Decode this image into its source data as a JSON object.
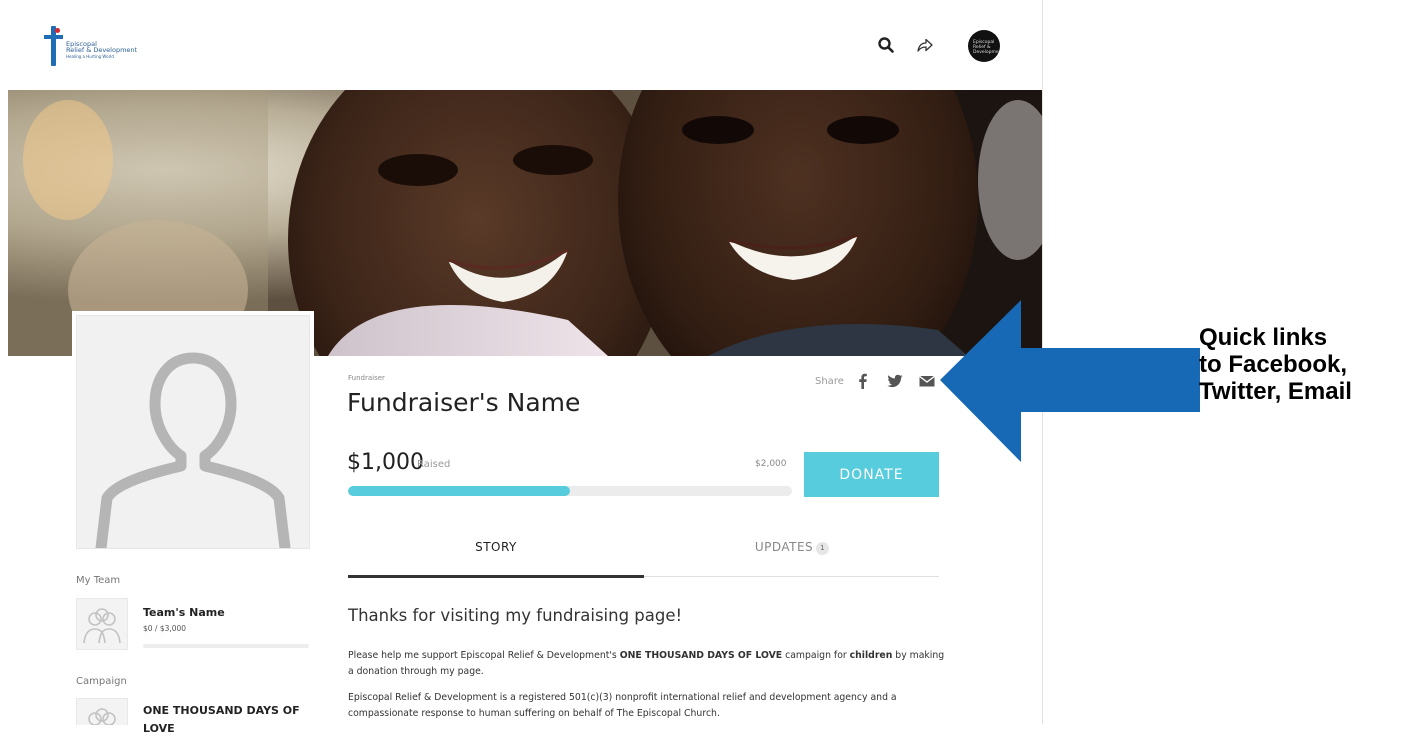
{
  "header": {
    "logo": {
      "line1": "Episcopal",
      "line2": "Relief & Development",
      "tagline": "Healing a Hurting World"
    },
    "icons": {
      "search": "search-icon",
      "share": "share-arrow-icon"
    },
    "avatar_text": "Episcopal Relief & Development"
  },
  "fundraiser": {
    "label": "Fundraiser",
    "name": "Fundraiser's Name",
    "share_label": "Share",
    "share_icons": [
      "facebook-icon",
      "twitter-icon",
      "email-icon"
    ],
    "raised": "$1,000",
    "raised_label": "Raised",
    "goal": "$2,000",
    "progress_fraction": 0.5,
    "donate_label": "DONATE"
  },
  "tabs": {
    "story": "STORY",
    "updates": "UPDATES",
    "updates_count": "1"
  },
  "story": {
    "heading": "Thanks for visiting my fundraising page!",
    "p1_a": "Please help me support Episcopal Relief & Development's ",
    "p1_b": "ONE THOUSAND DAYS OF LOVE",
    "p1_c": " campaign for ",
    "p1_d": "children",
    "p1_e": " by making a donation through my page.",
    "p2": "Episcopal Relief & Development is a registered 501(c)(3) nonprofit international relief and development agency and a compassionate response to human suffering on behalf of The Episcopal Church."
  },
  "sidebar": {
    "team_heading": "My Team",
    "team_name": "Team's Name",
    "team_progress": "$0 / $3,000",
    "team_progress_fraction": 0,
    "campaign_heading": "Campaign",
    "campaign_name": "ONE THOUSAND DAYS OF LOVE"
  },
  "annotation": {
    "line1": "Quick links",
    "line2": "to Facebook,",
    "line3": "Twitter, Email"
  },
  "colors": {
    "accent": "#56ccdc",
    "arrow": "#1768b5",
    "brand": "#1f6db5"
  }
}
